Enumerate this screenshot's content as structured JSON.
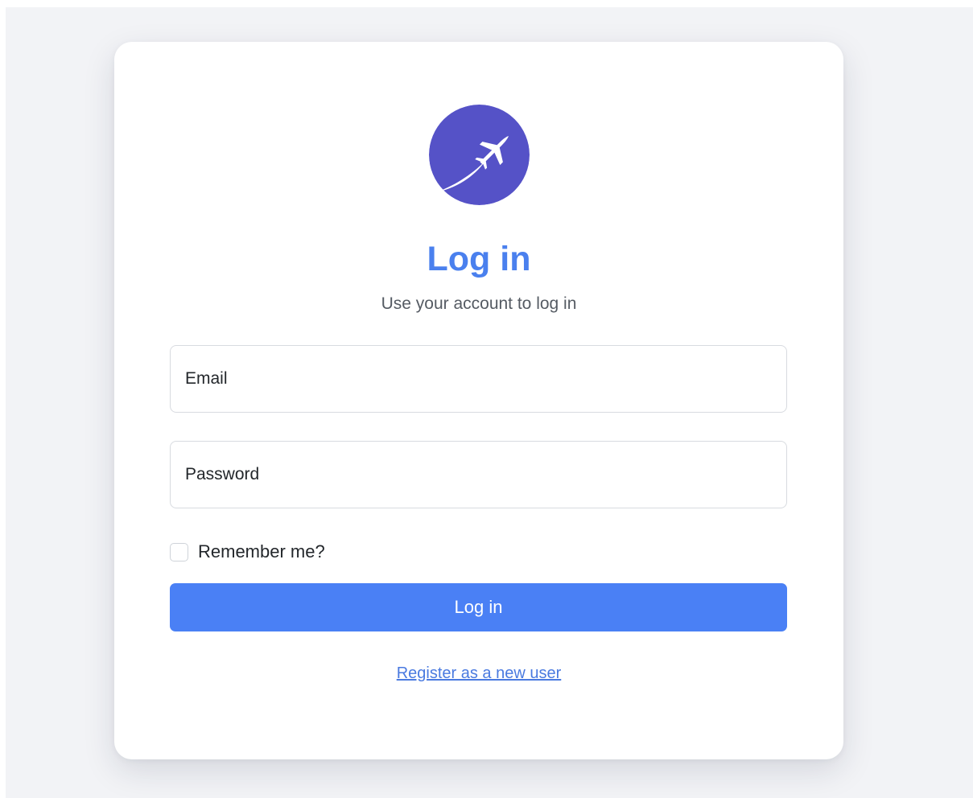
{
  "colors": {
    "accent": "#4a80ee",
    "button": "#4a80f5",
    "logo_background": "#5552c7",
    "page_background": "#f2f3f6",
    "card_background": "#ffffff",
    "link": "#4a7ae0"
  },
  "logo": {
    "icon": "airplane-icon"
  },
  "login": {
    "title": "Log in",
    "subtitle": "Use your account to log in",
    "email_placeholder": "Email",
    "password_placeholder": "Password",
    "remember_label": "Remember me?",
    "remember_checked": false,
    "submit_label": "Log in",
    "register_link": "Register as a new user"
  }
}
